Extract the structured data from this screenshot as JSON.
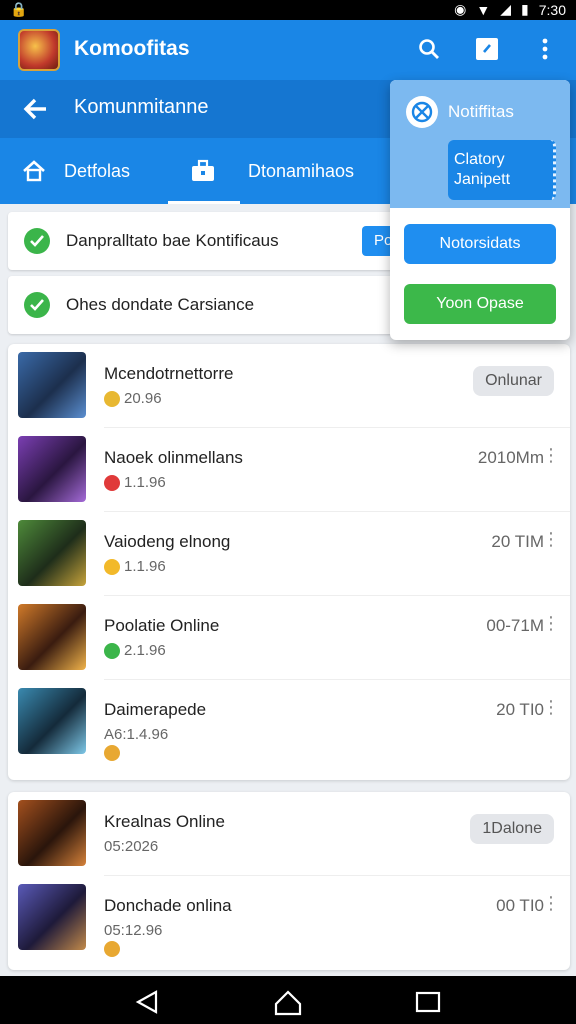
{
  "status_bar": {
    "time": "7:30"
  },
  "header": {
    "title": "Komoofitas",
    "logo_icon": "game-logo-icon",
    "accent": "#1a86e6"
  },
  "sub_header": {
    "title": "Komunmitanne"
  },
  "tabs": [
    {
      "label": "Detfolas",
      "icon": "home-icon"
    },
    {
      "label": "Dtonamihaos",
      "icon": "briefcase-icon"
    }
  ],
  "notices": [
    {
      "text": "Danpralltato bae Kontificaus",
      "button": "Po"
    },
    {
      "text": "Ohes dondate Carsiance"
    }
  ],
  "dropdown": {
    "title": "Notiffitas",
    "sub_label": "Clatory Janipett",
    "button_blue": "Notorsidats",
    "button_green": "Yoon Opase"
  },
  "list_1": [
    {
      "name": "Mcendotrnettorre",
      "meta": "20.96",
      "meta_icon": "trophy-icon",
      "extra": "",
      "pill": "Onlunar"
    },
    {
      "name": "Naoek olinmellans",
      "meta": "1.1.96",
      "meta_icon": "heart-icon",
      "extra": "2010Mm",
      "pill": ""
    },
    {
      "name": "Vaiodeng elnong",
      "meta": "1.1.96",
      "meta_icon": "star-icon",
      "extra": "20 TIM",
      "pill": ""
    },
    {
      "name": "Poolatie Online",
      "meta": "2.1.96",
      "meta_icon": "check-icon",
      "extra": "00-71M",
      "pill": ""
    },
    {
      "name": "Daimerapede",
      "meta": "A6:1.4.96",
      "meta_icon": "coin-icon",
      "extra": "20 TI0",
      "pill": ""
    }
  ],
  "list_2": [
    {
      "name": "Krealnas Online",
      "meta": "05:2026",
      "meta_icon": "",
      "extra": "",
      "pill": "1Dalone"
    },
    {
      "name": "Donchade onlina",
      "meta": "05:12.96",
      "meta_icon": "heart-icon",
      "extra": "00 TI0",
      "pill": ""
    }
  ]
}
